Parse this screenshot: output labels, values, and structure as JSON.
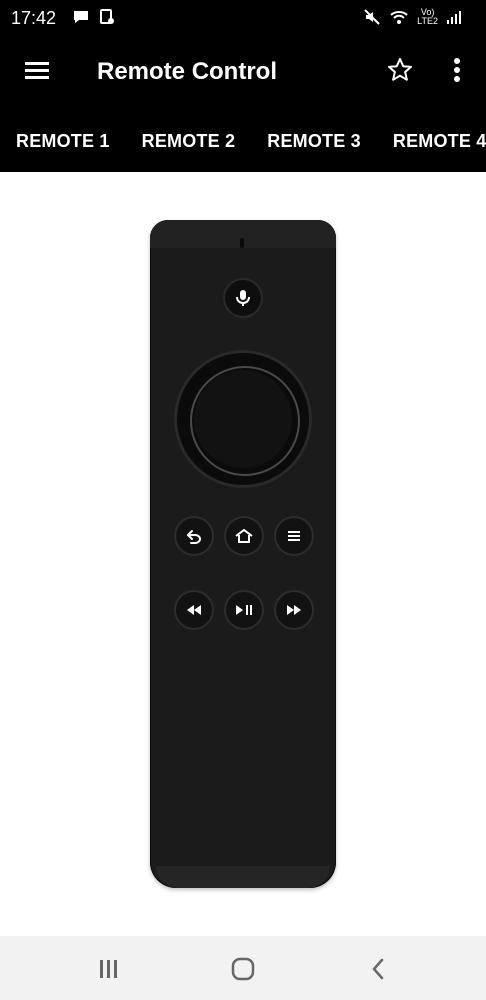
{
  "status": {
    "time": "17:42",
    "network_label": "LTE2",
    "volte_label": "Vo)"
  },
  "app_bar": {
    "title": "Remote Control"
  },
  "tabs": [
    {
      "label": "REMOTE 1"
    },
    {
      "label": "REMOTE 2"
    },
    {
      "label": "REMOTE 3"
    },
    {
      "label": "REMOTE 4"
    }
  ],
  "remote": {
    "buttons_row1": [
      "back-icon",
      "home-icon",
      "menu-icon"
    ],
    "buttons_row2": [
      "rewind-icon",
      "play-pause-icon",
      "fast-forward-icon"
    ]
  },
  "colors": {
    "app_bar": "#000000",
    "remote_body": "#1b1b1b",
    "nav_bar": "#f2f2f2"
  }
}
